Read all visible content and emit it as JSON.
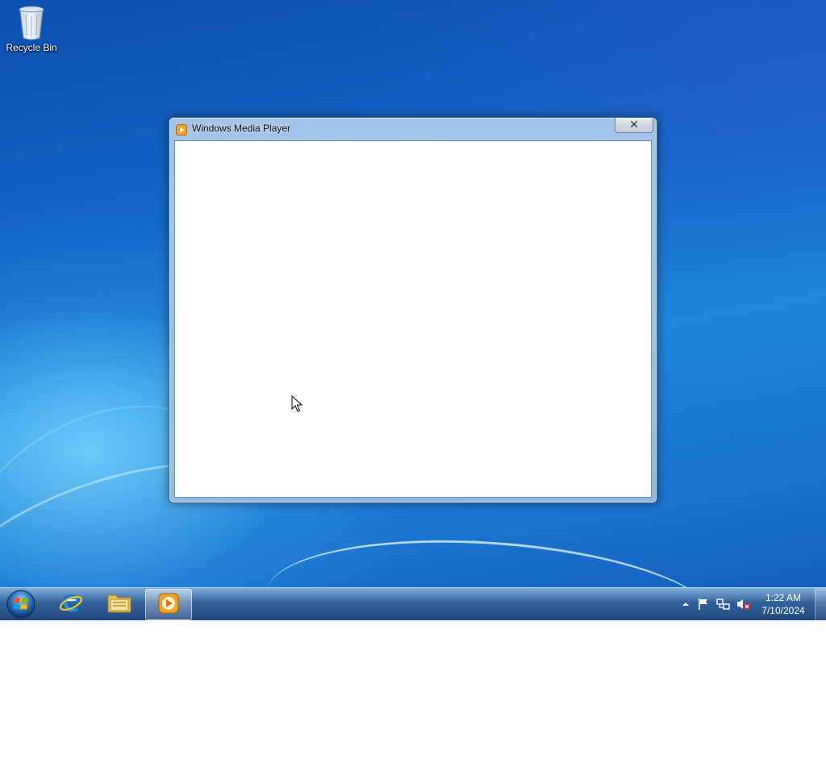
{
  "desktop": {
    "icons": [
      {
        "label": "Recycle Bin",
        "icon": "recycle-bin-icon"
      }
    ]
  },
  "window": {
    "title": "Windows Media Player",
    "icon": "windows-media-player-icon",
    "close_label": "✕"
  },
  "taskbar": {
    "start_icon": "windows-start-orb-icon",
    "pinned": [
      {
        "name": "Internet Explorer",
        "icon": "internet-explorer-icon"
      },
      {
        "name": "Windows Explorer",
        "icon": "folder-library-icon"
      },
      {
        "name": "Windows Media Player",
        "icon": "windows-media-player-icon",
        "active": true
      }
    ],
    "tray": {
      "icons": [
        "show-hidden-icons-arrow-icon",
        "action-center-flag-icon",
        "network-icon",
        "volume-muted-icon"
      ],
      "time": "1:22 AM",
      "date": "7/10/2024"
    }
  }
}
